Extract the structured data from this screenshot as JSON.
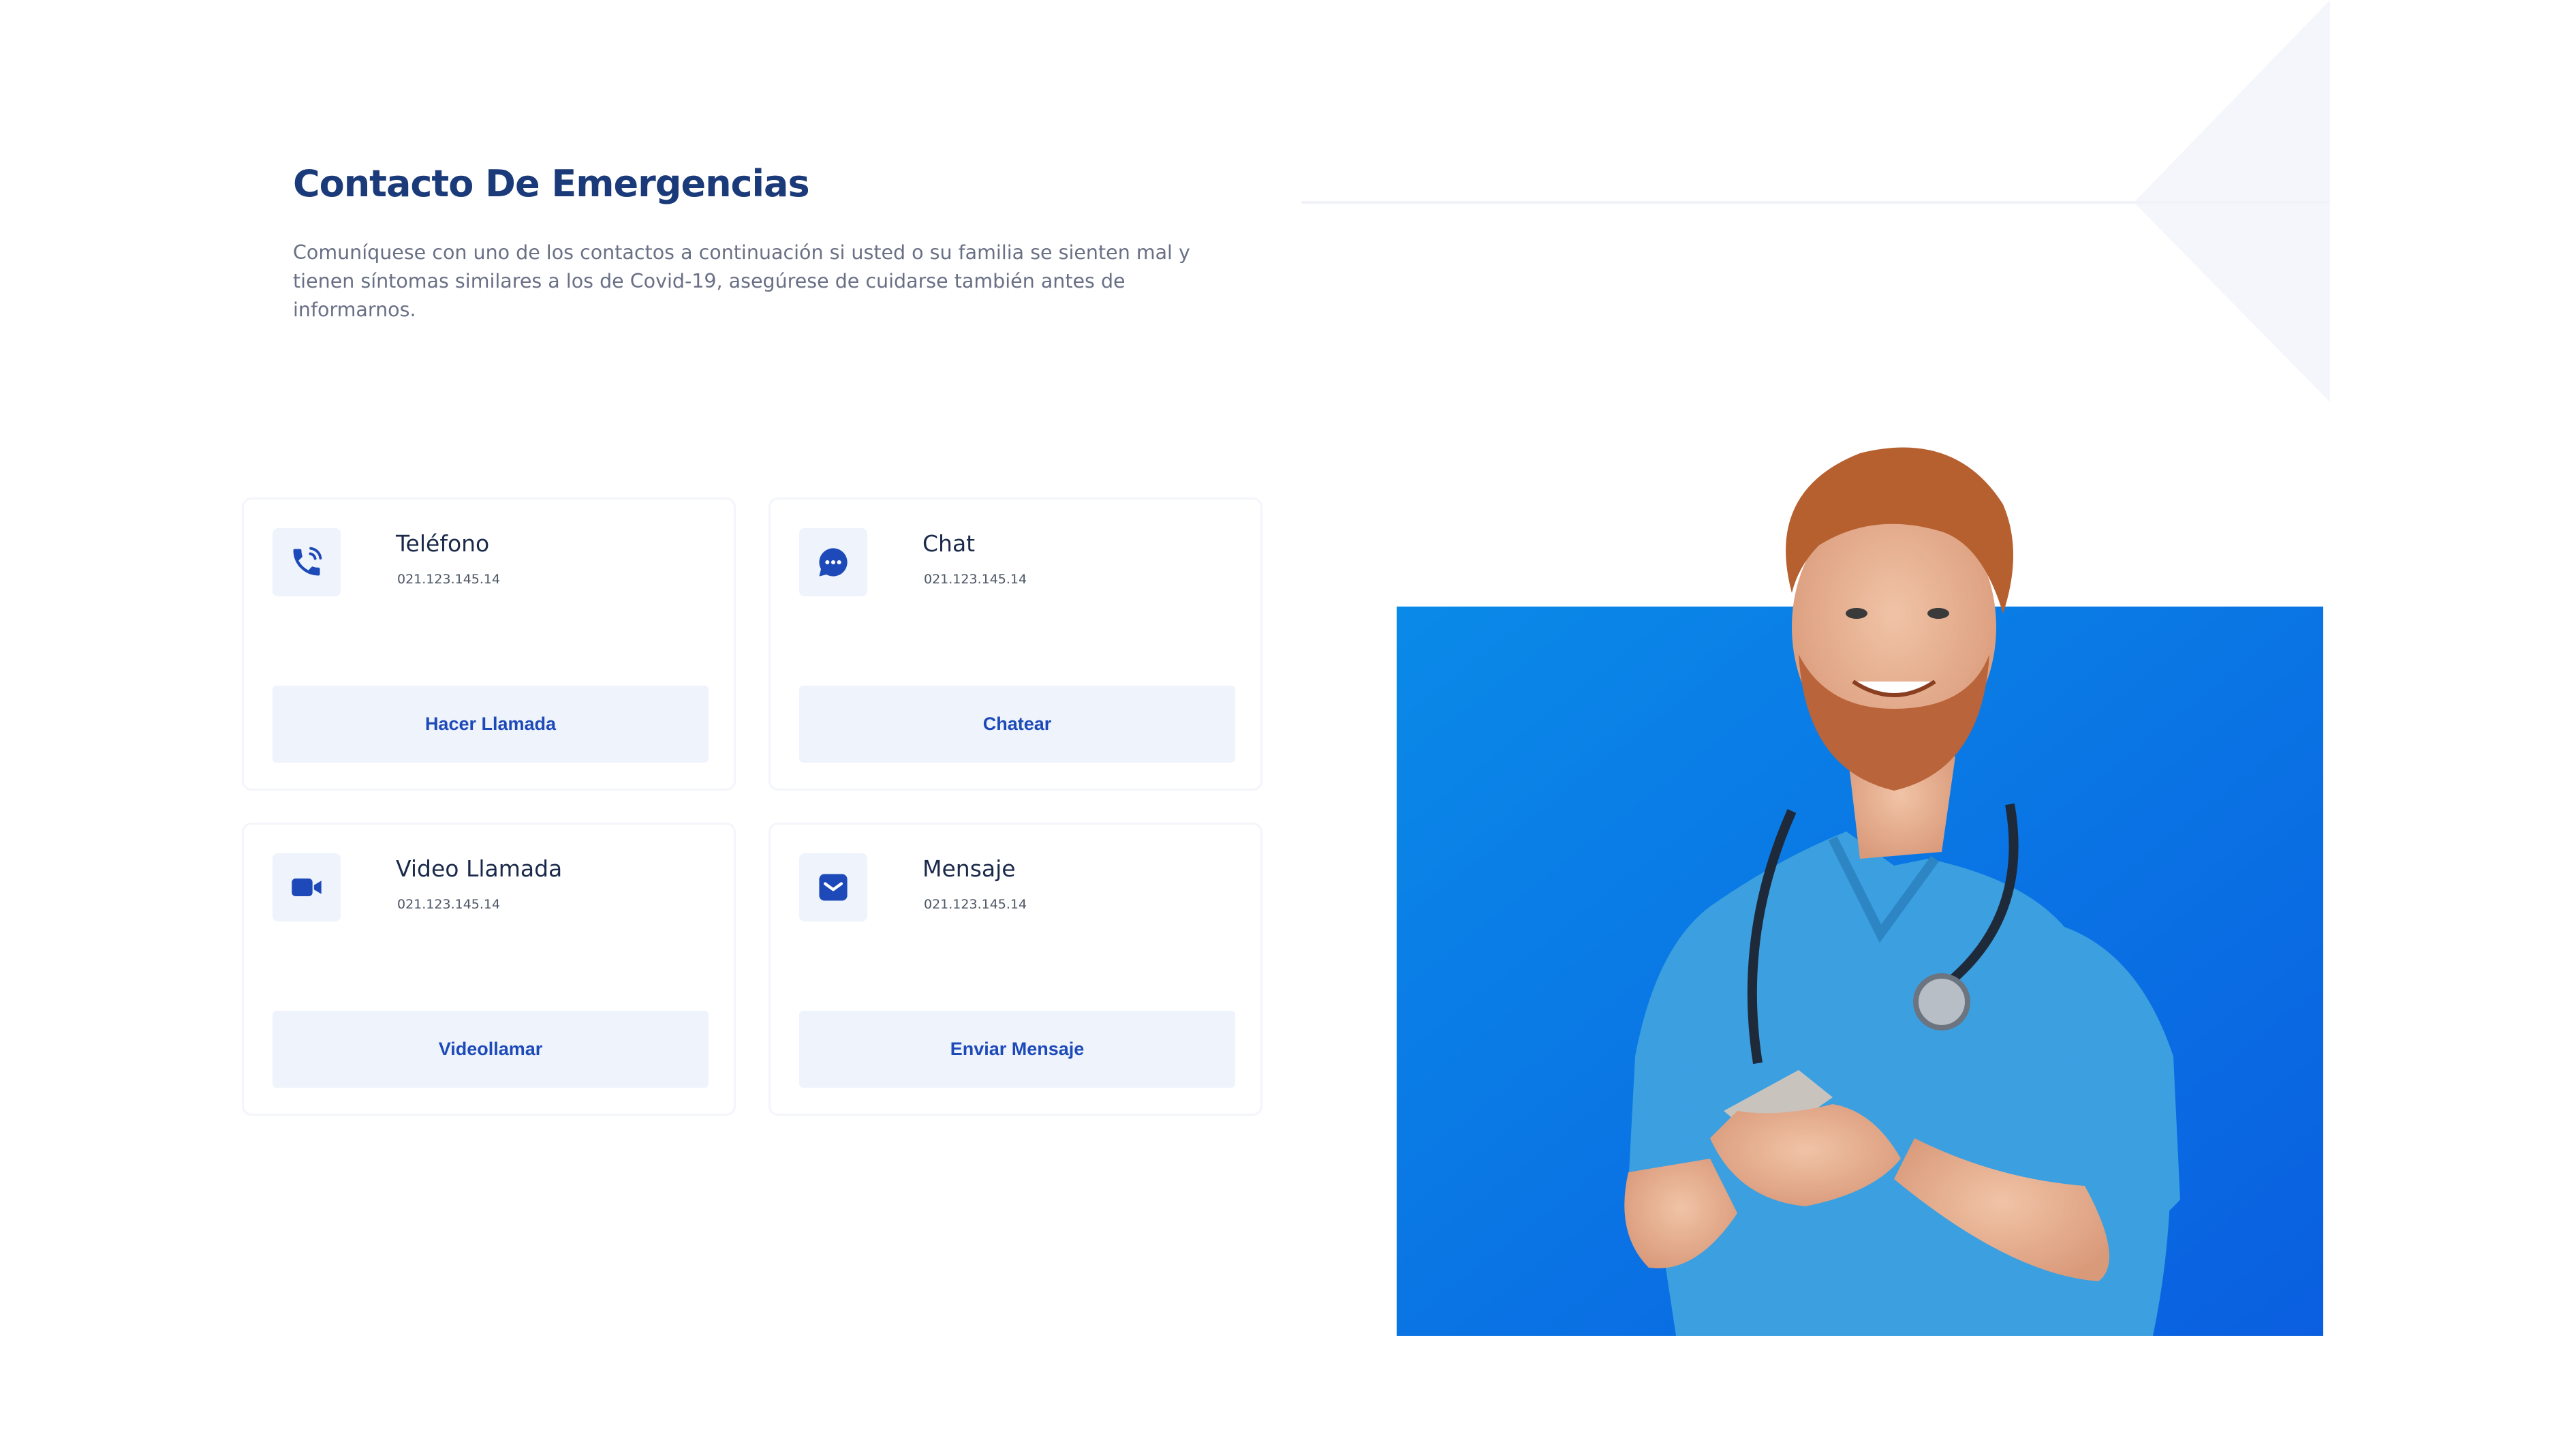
{
  "section": {
    "title": "Contacto De Emergencias",
    "description": "Comuníquese con uno de los contactos a continuación si usted o su familia se sienten mal y tienen síntomas similares a los de Covid-19, asegúrese de cuidarse también antes de informarnos."
  },
  "contacts": [
    {
      "title": "Teléfono",
      "number": "021.123.145.14",
      "button": "Hacer Llamada",
      "icon": "phone-icon"
    },
    {
      "title": "Chat",
      "number": "021.123.145.14",
      "button": "Chatear",
      "icon": "chat-bubble-icon"
    },
    {
      "title": "Video Llamada",
      "number": "021.123.145.14",
      "button": "Videollamar",
      "icon": "video-camera-icon"
    },
    {
      "title": "Mensaje",
      "number": "021.123.145.14",
      "button": "Enviar Mensaje",
      "icon": "envelope-icon"
    }
  ],
  "colors": {
    "accent": "#1d4ab8",
    "title": "#1b3a7a",
    "button_bg": "#eef3fc",
    "photo_bg": "#0a76e6"
  }
}
